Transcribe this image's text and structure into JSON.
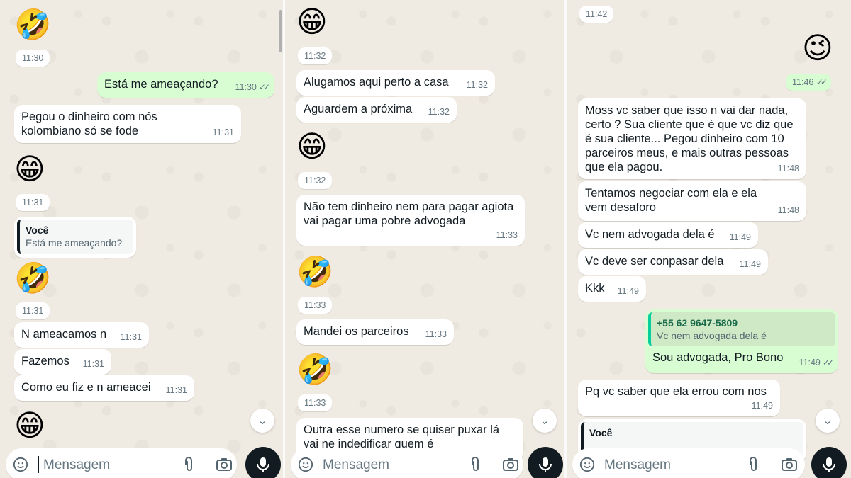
{
  "composer": {
    "placeholder": "Mensagem"
  },
  "panel1": {
    "times": {
      "e1": "11:30",
      "out1_text": "Está me ameaçando?",
      "out1_time": "11:30",
      "in1_text": "Pegou o dinheiro com nós kolombiano só se fode",
      "in1_time": "11:31",
      "e2": "11:31",
      "e3": "11:31",
      "m1_text": "N ameacamos n",
      "m1_time": "11:31",
      "m2_text": "Fazemos",
      "m2_time": "11:31",
      "m3_text": "Como eu fiz e n ameacei",
      "m3_time": "11:31"
    },
    "quote": {
      "name": "Você",
      "text": "Está me ameaçando?"
    }
  },
  "panel2": {
    "e1": "11:32",
    "m1_text": "Alugamos aqui perto a casa",
    "m1_time": "11:32",
    "m2_text": "Aguardem a próxima",
    "m2_time": "11:32",
    "e2": "11:32",
    "m3_text": "Não tem dinheiro nem para pagar agiota vai pagar uma pobre advogada",
    "m3_time": "11:33",
    "e3": "11:33",
    "m4_text": "Mandei os parceiros",
    "m4_time": "11:33",
    "e4": "11:33",
    "m5_text": "Outra esse numero se quiser puxar lá vai ne indedificar quem é"
  },
  "panel3": {
    "t0": "11:42",
    "e_out": "11:46",
    "m1_text": "Moss vc saber que isso n vai dar nada, certo ? Sua cliente que é que vc diz que é sua cliente... Pegou dinheiro com 10 parceiros meus, e mais outras pessoas que ela pagou.",
    "m1_time": "11:48",
    "m2_text": "Tentamos negociar com ela e ela vem desaforo",
    "m2_time": "11:48",
    "m3_text": "Vc nem advogada dela é",
    "m3_time": "11:49",
    "m4_text": "Vc deve ser conpasar dela",
    "m4_time": "11:49",
    "m5_text": "Kkk",
    "m5_time": "11:49",
    "out_quote_name": "+55 62 9647-5809",
    "out_quote_text": "Vc nem advogada dela é",
    "out_text": "Sou advogada, Pro Bono",
    "out_time": "11:49",
    "m6_text": "Pq vc saber que ela errou com nos",
    "m6_time": "11:49",
    "quote2_name": "Você"
  },
  "emojis": {
    "laugh": "🤣",
    "grin": "😁",
    "wink": "😉"
  }
}
